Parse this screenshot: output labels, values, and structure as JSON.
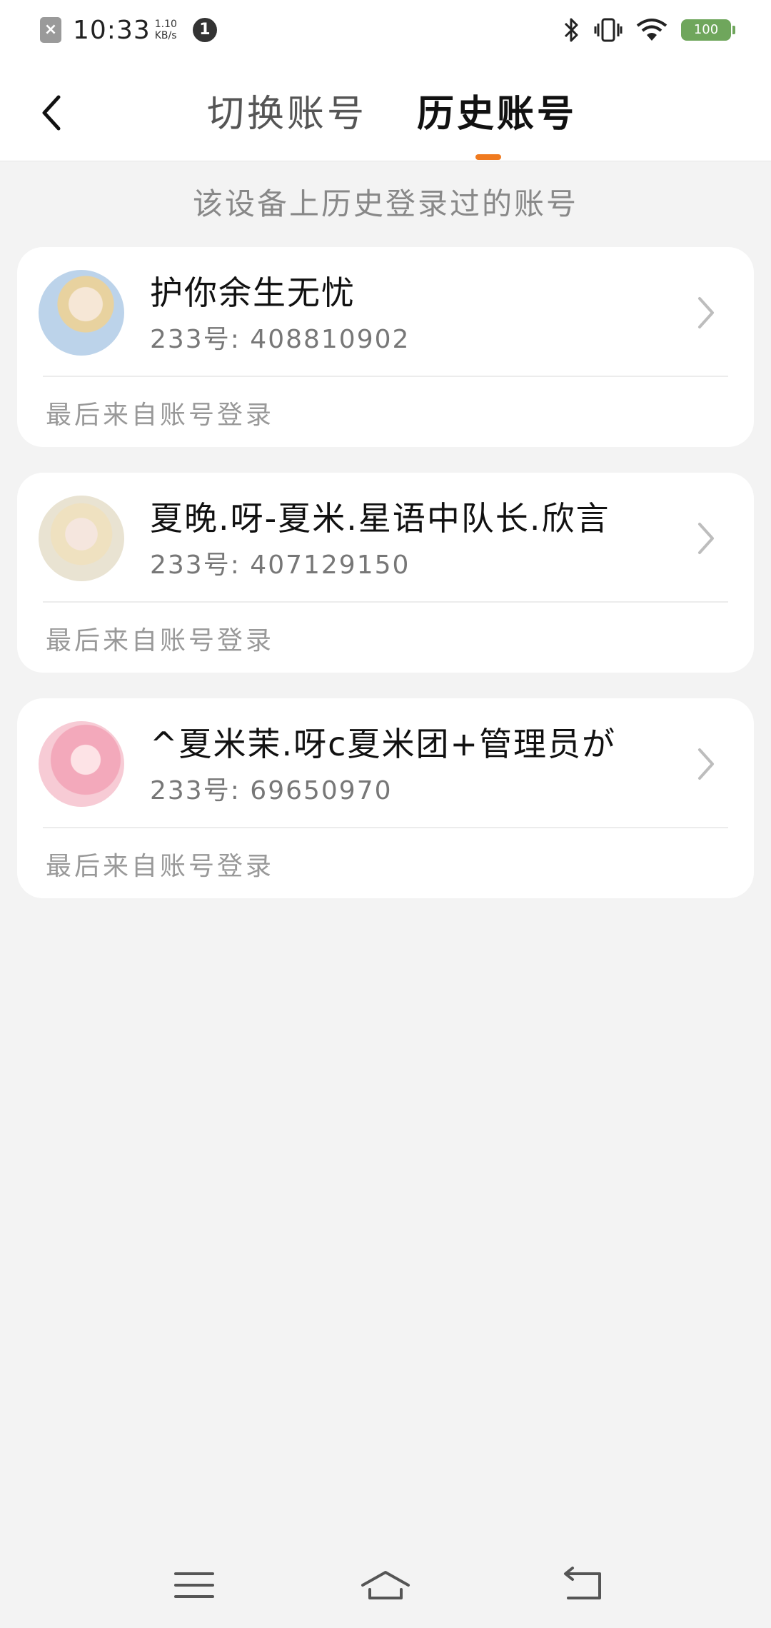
{
  "status_bar": {
    "time": "10:33",
    "speed_value": "1.10",
    "speed_unit": "KB/s",
    "notification_count": "1",
    "battery": "100"
  },
  "header": {
    "tabs": [
      {
        "label": "切换账号",
        "active": false
      },
      {
        "label": "历史账号",
        "active": true
      }
    ],
    "accent_color": "#f07a1f"
  },
  "subtitle": "该设备上历史登录过的账号",
  "accounts": [
    {
      "nickname": "护你余生无忧",
      "uid": "233号: 408810902",
      "login_source": "最后来自账号登录"
    },
    {
      "nickname": "夏晚.呀-夏米.星语中队长.欣言",
      "uid": "233号: 407129150",
      "login_source": "最后来自账号登录"
    },
    {
      "nickname": "^夏米茉.呀c夏米团+管理员が",
      "uid": "233号: 69650970",
      "login_source": "最后来自账号登录"
    }
  ],
  "icons": {
    "back": "back-arrow-icon",
    "chevron": "chevron-right-icon",
    "nav_menu": "menu-icon",
    "nav_home": "home-icon",
    "nav_back": "return-icon"
  }
}
